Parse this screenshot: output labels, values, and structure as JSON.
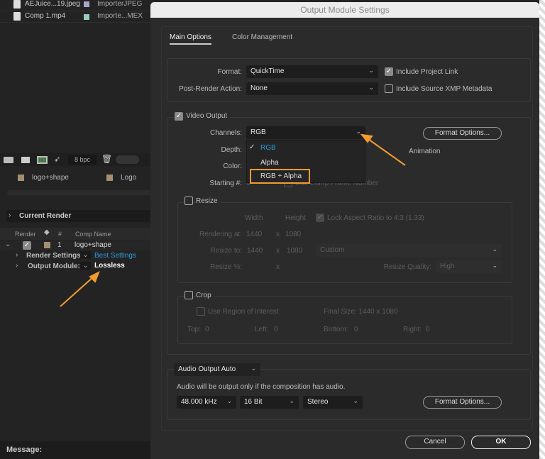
{
  "project_panel": {
    "items": [
      {
        "name": "AEJuice...19.jpeg",
        "type": "ImporterJPEG",
        "color": "#a9a6c8"
      },
      {
        "name": "Comp 1.mp4",
        "type": "Importe...MEX",
        "color": "#9cc9bd"
      }
    ],
    "bpc": "8 bpc"
  },
  "timeline_tabs": [
    {
      "label": "logo+shape",
      "color": "#a38f72"
    },
    {
      "label": "Logo",
      "color": "#a38f72"
    }
  ],
  "render_queue": {
    "current_render": "Current Render",
    "columns": [
      "Render",
      "#",
      "Comp Name"
    ],
    "item": {
      "index": "1",
      "comp": "logo+shape",
      "render_settings_label": "Render Settings:",
      "render_settings": "Best Settings",
      "output_module_label": "Output Module:",
      "output_module": "Lossless"
    },
    "message_label": "Message:"
  },
  "dialog": {
    "title": "Output Module Settings",
    "tabs": [
      "Main Options",
      "Color Management"
    ],
    "format_label": "Format:",
    "format": "QuickTime",
    "post_render_label": "Post-Render Action:",
    "post_render": "None",
    "include_project_link": "Include Project Link",
    "include_xmp": "Include Source XMP Metadata",
    "video_output": "Video Output",
    "channels_label": "Channels:",
    "channels": "RGB",
    "channel_options": [
      "RGB",
      "Alpha",
      "RGB + Alpha"
    ],
    "format_options": "Format Options...",
    "codec": "Animation",
    "depth_label": "Depth:",
    "color_label": "Color:",
    "starting_label": "Starting #:",
    "starting": "0",
    "use_comp_frame": "Use Comp Frame Number",
    "resize": "Resize",
    "width": "Width",
    "height": "Height",
    "lock_aspect": "Lock Aspect Ratio to 4:3 (1.33)",
    "rendering_at_label": "Rendering at:",
    "render_w": "1440",
    "render_h": "1080",
    "x": "x",
    "resize_to_label": "Resize to:",
    "resize_w": "1440",
    "resize_h": "1080",
    "resize_preset": "Custom",
    "resize_pct_label": "Resize %:",
    "resize_quality_label": "Resize Quality:",
    "resize_quality": "High",
    "crop": "Crop",
    "use_roi": "Use Region of Interest",
    "final_size": "Final Size: 1440 x 1080",
    "top": "Top:",
    "left": "Left:",
    "bottom": "Bottom:",
    "right": "Right:",
    "zero": "0",
    "audio_output": "Audio Output Auto",
    "audio_note": "Audio will be output only if the composition has audio.",
    "sample_rate": "48.000 kHz",
    "bit_depth": "16 Bit",
    "channels_audio": "Stereo",
    "audio_format_options": "Format Options...",
    "cancel": "Cancel",
    "ok": "OK"
  },
  "colors": {
    "accent": "#f29b2f",
    "link": "#2d9cdb"
  }
}
